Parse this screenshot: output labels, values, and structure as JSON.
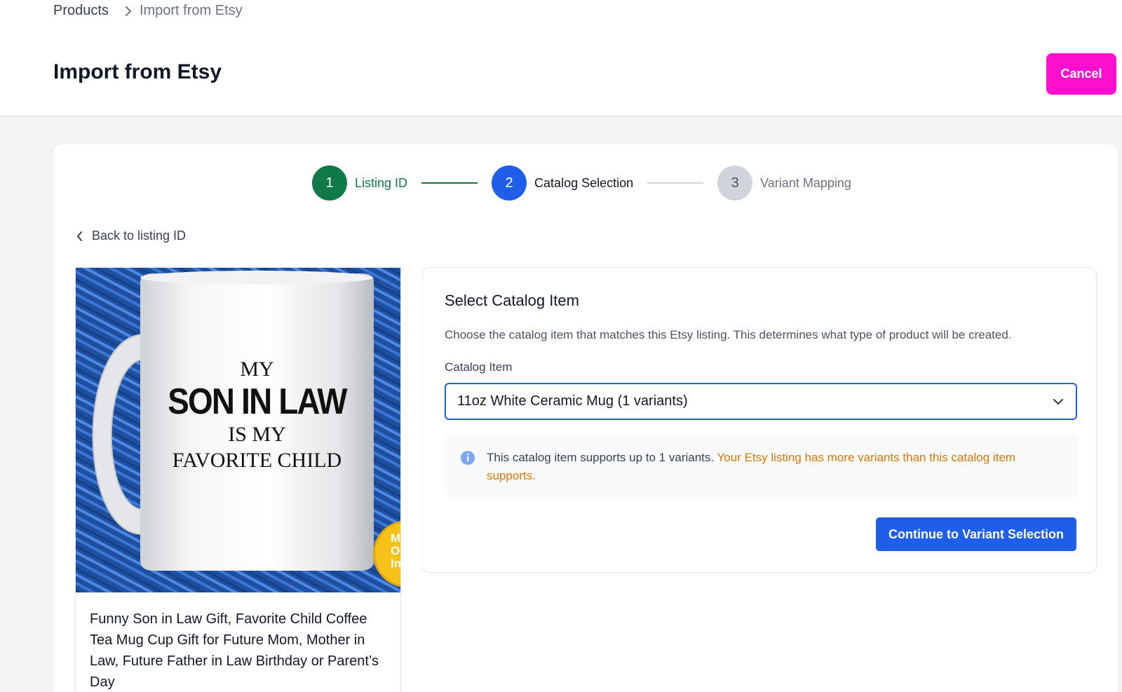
{
  "breadcrumb": {
    "root": "Products",
    "current": "Import from Etsy"
  },
  "page": {
    "title": "Import from Etsy",
    "cancel_label": "Cancel"
  },
  "stepper": {
    "steps": [
      {
        "number": "1",
        "label": "Listing ID",
        "state": "done"
      },
      {
        "number": "2",
        "label": "Catalog Selection",
        "state": "active"
      },
      {
        "number": "3",
        "label": "Variant Mapping",
        "state": "todo"
      }
    ]
  },
  "back_link": "Back to listing ID",
  "product": {
    "mug_text": {
      "line1": "MY",
      "line2": "SON IN LAW",
      "line3": "IS MY",
      "line4": "FAVORITE CHILD"
    },
    "badge_text": {
      "line1": "M",
      "line2": "Op",
      "line3": "In"
    },
    "title": "Funny Son in Law Gift, Favorite Child Coffee Tea Mug Cup Gift for Future Mom, Mother in Law, Future Father in Law Birthday or Parent’s Day"
  },
  "catalog": {
    "title": "Select Catalog Item",
    "description": "Choose the catalog item that matches this Etsy listing. This determines what type of product will be created.",
    "field_label": "Catalog Item",
    "selected_value": "11oz White Ceramic Mug (1 variants)",
    "info_text": "This catalog item supports up to 1 variants.",
    "info_warning": "Your Etsy listing has more variants than this catalog item supports.",
    "continue_label": "Continue to Variant Selection"
  },
  "colors": {
    "accent": "#1e5ee8",
    "success": "#0f7a48",
    "cancel": "#ff0fce",
    "warning": "#d97706"
  },
  "icons": [
    "chevron-right-icon",
    "chevron-left-icon",
    "chevron-down-icon",
    "info-icon"
  ]
}
